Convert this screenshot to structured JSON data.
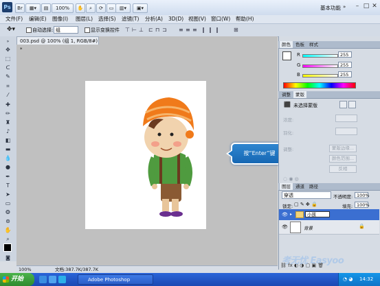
{
  "titlebar": {
    "app_logo": "Ps",
    "zoom": "100%",
    "workspace": "基本功能",
    "minimize": "–",
    "restore": "□",
    "close": "✕"
  },
  "menu": [
    "文件(F)",
    "编辑(E)",
    "图像(I)",
    "图层(L)",
    "选择(S)",
    "滤镜(T)",
    "分析(A)",
    "3D(D)",
    "视图(V)",
    "窗口(W)",
    "帮助(H)"
  ],
  "options": {
    "auto_select_label": "自动选择:",
    "auto_select_value": "组",
    "show_transform_label": "显示变换控件"
  },
  "document": {
    "tab_title": "003.psd @ 100% (组 1, RGB/8#) *",
    "status_zoom": "100%",
    "status_doc": "文档:387.7K/387.7K"
  },
  "callout": {
    "text": "按“Enter”键"
  },
  "color_panel": {
    "tabs": [
      "颜色",
      "色板",
      "样式"
    ],
    "r_label": "R",
    "g_label": "G",
    "b_label": "B",
    "r_value": "255",
    "g_value": "255",
    "b_value": "255"
  },
  "adjust_panel": {
    "tabs": [
      "调整",
      "蒙版"
    ],
    "mask_title": "未选择蒙版",
    "density_label": "浓度:",
    "feather_label": "羽化:",
    "refine_label": "调整:",
    "btn_edge": "蒙版边缘...",
    "btn_color_range": "颜色范围...",
    "btn_invert": "反相"
  },
  "layers_panel": {
    "tabs": [
      "图层",
      "通道",
      "路径"
    ],
    "blend_mode": "穿透",
    "opacity_label": "不透明度:",
    "opacity_value": "100%",
    "lock_label": "锁定:",
    "fill_label": "填充:",
    "fill_value": "100%",
    "layers": [
      {
        "name": "小孩",
        "type": "group",
        "selected": true
      },
      {
        "name": "背景",
        "type": "image",
        "selected": false
      }
    ]
  },
  "taskbar": {
    "start_label": "开始",
    "task_label": "Adobe Photoshop",
    "clock": "14:32"
  },
  "watermark": "考无忧 Easyoo",
  "colors": {
    "taskbar": "#1b49b3",
    "start": "#2f8a2f",
    "callout": "#1667b3",
    "canvas_bg": "#c0c0c0"
  }
}
